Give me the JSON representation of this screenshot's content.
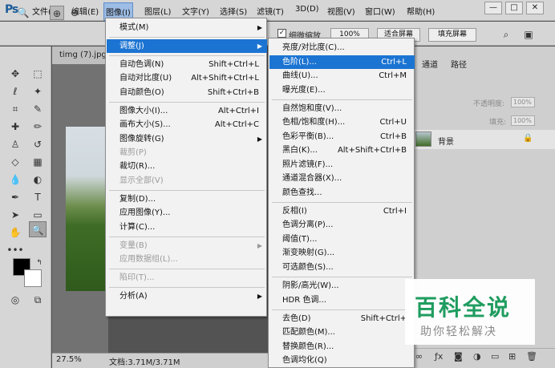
{
  "app": {
    "logo": "Ps"
  },
  "menubar": {
    "items": [
      "文件(F)",
      "编辑(E)",
      "图像(I)",
      "图层(L)",
      "文字(Y)",
      "选择(S)",
      "滤镜(T)",
      "3D(D)",
      "视图(V)",
      "窗口(W)",
      "帮助(H)"
    ],
    "active_index": 2
  },
  "window_controls": {
    "minimize": "—",
    "restore": "□",
    "close": "✕"
  },
  "options": {
    "checkbox_label": "细微缩放",
    "zoom_value": "100%",
    "fit_screen": "适合屏幕",
    "fill_screen": "填充屏幕"
  },
  "document": {
    "tab": "timg (7).jpg",
    "zoom": "27.5%",
    "doc_info": "文档:3.71M/3.71M"
  },
  "panels": {
    "tabs": [
      "通道",
      "路径"
    ],
    "opacity_label": "不透明度:",
    "opacity_value": "100%",
    "fill_label": "填充:",
    "fill_value": "100%",
    "layer_name": "背景"
  },
  "image_menu": {
    "items": [
      {
        "label": "模式(M)",
        "shortcut": "",
        "submenu": true,
        "disabled": false
      },
      {
        "sep": true
      },
      {
        "label": "调整(J)",
        "shortcut": "",
        "submenu": true,
        "disabled": false,
        "highlight": true
      },
      {
        "sep": true
      },
      {
        "label": "自动色调(N)",
        "shortcut": "Shift+Ctrl+L",
        "disabled": false
      },
      {
        "label": "自动对比度(U)",
        "shortcut": "Alt+Shift+Ctrl+L",
        "disabled": false
      },
      {
        "label": "自动颜色(O)",
        "shortcut": "Shift+Ctrl+B",
        "disabled": false
      },
      {
        "sep": true
      },
      {
        "label": "图像大小(I)...",
        "shortcut": "Alt+Ctrl+I",
        "disabled": false
      },
      {
        "label": "画布大小(S)...",
        "shortcut": "Alt+Ctrl+C",
        "disabled": false
      },
      {
        "label": "图像旋转(G)",
        "shortcut": "",
        "submenu": true,
        "disabled": false
      },
      {
        "label": "裁剪(P)",
        "shortcut": "",
        "disabled": true
      },
      {
        "label": "裁切(R)...",
        "shortcut": "",
        "disabled": false
      },
      {
        "label": "显示全部(V)",
        "shortcut": "",
        "disabled": true
      },
      {
        "sep": true
      },
      {
        "label": "复制(D)...",
        "shortcut": "",
        "disabled": false
      },
      {
        "label": "应用图像(Y)...",
        "shortcut": "",
        "disabled": false
      },
      {
        "label": "计算(C)...",
        "shortcut": "",
        "disabled": false
      },
      {
        "sep": true
      },
      {
        "label": "变量(B)",
        "shortcut": "",
        "submenu": true,
        "disabled": true
      },
      {
        "label": "应用数据组(L)...",
        "shortcut": "",
        "disabled": true
      },
      {
        "sep": true
      },
      {
        "label": "陷印(T)...",
        "shortcut": "",
        "disabled": true
      },
      {
        "sep": true
      },
      {
        "label": "分析(A)",
        "shortcut": "",
        "submenu": true,
        "disabled": false
      }
    ]
  },
  "adjust_menu": {
    "items": [
      {
        "label": "亮度/对比度(C)...",
        "shortcut": ""
      },
      {
        "label": "色阶(L)...",
        "shortcut": "Ctrl+L",
        "highlight": true
      },
      {
        "label": "曲线(U)...",
        "shortcut": "Ctrl+M"
      },
      {
        "label": "曝光度(E)...",
        "shortcut": ""
      },
      {
        "sep": true
      },
      {
        "label": "自然饱和度(V)...",
        "shortcut": ""
      },
      {
        "label": "色相/饱和度(H)...",
        "shortcut": "Ctrl+U"
      },
      {
        "label": "色彩平衡(B)...",
        "shortcut": "Ctrl+B"
      },
      {
        "label": "黑白(K)...",
        "shortcut": "Alt+Shift+Ctrl+B"
      },
      {
        "label": "照片滤镜(F)...",
        "shortcut": ""
      },
      {
        "label": "通道混合器(X)...",
        "shortcut": ""
      },
      {
        "label": "颜色查找...",
        "shortcut": ""
      },
      {
        "sep": true
      },
      {
        "label": "反相(I)",
        "shortcut": "Ctrl+I"
      },
      {
        "label": "色调分离(P)...",
        "shortcut": ""
      },
      {
        "label": "阈值(T)...",
        "shortcut": ""
      },
      {
        "label": "渐变映射(G)...",
        "shortcut": ""
      },
      {
        "label": "可选颜色(S)...",
        "shortcut": ""
      },
      {
        "sep": true
      },
      {
        "label": "阴影/高光(W)...",
        "shortcut": ""
      },
      {
        "label": "HDR 色调...",
        "shortcut": ""
      },
      {
        "sep": true
      },
      {
        "label": "去色(D)",
        "shortcut": "Shift+Ctrl+"
      },
      {
        "label": "匹配颜色(M)...",
        "shortcut": ""
      },
      {
        "label": "替换颜色(R)...",
        "shortcut": ""
      },
      {
        "label": "色调均化(Q)",
        "shortcut": ""
      }
    ]
  },
  "watermark": {
    "title": "百科全说",
    "subtitle": "助你轻松解决"
  },
  "colors": {
    "highlight": "#1c74d2",
    "menu_bg": "#f2f2f2",
    "watermark_green": "#1f9c5f"
  }
}
